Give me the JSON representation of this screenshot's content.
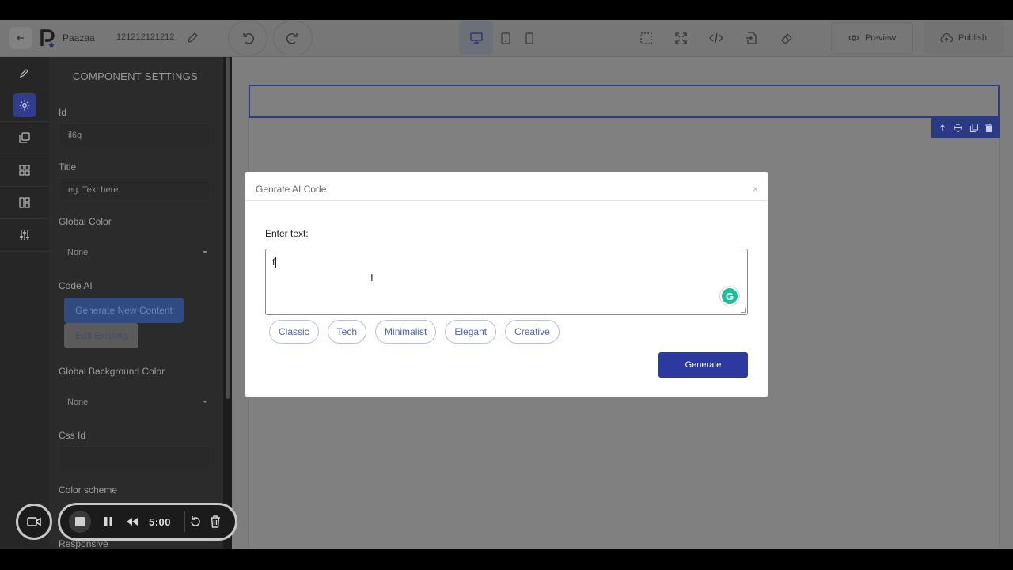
{
  "app": {
    "name": "Paazaa",
    "page_id": "121212121212"
  },
  "toolbar": {
    "preview_label": "Preview",
    "publish_label": "Publish",
    "active_device": "desktop"
  },
  "panel": {
    "title": "COMPONENT SETTINGS",
    "id_label": "Id",
    "id_value": "il6q",
    "title_label": "Title",
    "title_placeholder": "eg. Text here",
    "global_color_label": "Global Color",
    "global_color_value": "None",
    "code_ai_label": "Code AI",
    "generate_new_label": "Generate New Content",
    "edit_existing_label": "Edit Existing",
    "global_bg_label": "Global Background Color",
    "global_bg_value": "None",
    "css_id_label": "Css Id",
    "color_scheme_label": "Color scheme",
    "responsive_label": "Responsive"
  },
  "modal": {
    "title": "Genrate AI Code",
    "close_symbol": "×",
    "enter_text_label": "Enter text:",
    "textarea_value": "f",
    "styles": [
      "Classic",
      "Tech",
      "Minimalist",
      "Elegant",
      "Creative"
    ],
    "generate_label": "Generate"
  },
  "recorder": {
    "time": "5:00"
  },
  "colors": {
    "accent": "#2c3a9f",
    "chip_text": "#4c62b6",
    "selection": "#2a3a8c",
    "grammarly": "#15c39a"
  }
}
